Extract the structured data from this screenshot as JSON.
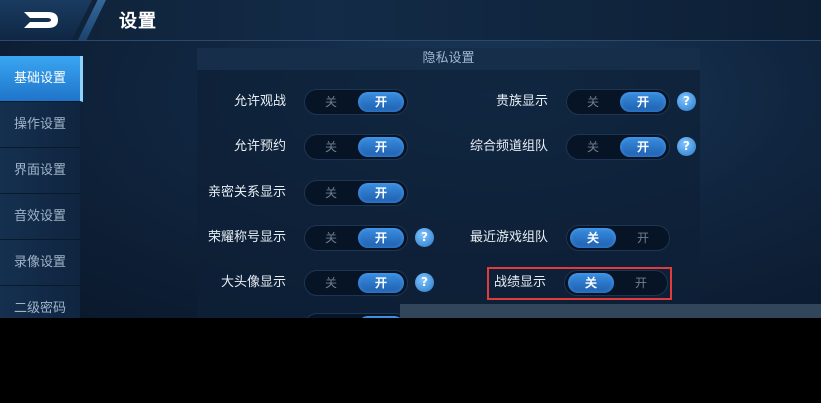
{
  "header": {
    "title": "设置"
  },
  "sidebar": {
    "items": [
      {
        "label": "基础设置",
        "active": true
      },
      {
        "label": "操作设置"
      },
      {
        "label": "界面设置"
      },
      {
        "label": "音效设置"
      },
      {
        "label": "录像设置"
      },
      {
        "label": "二级密码"
      }
    ]
  },
  "panel": {
    "title": "隐私设置"
  },
  "toggle_text": {
    "off": "关",
    "on": "开"
  },
  "help_glyph": "?",
  "left_settings": [
    {
      "label": "允许观战",
      "state": "开",
      "help": false
    },
    {
      "label": "允许预约",
      "state": "开",
      "help": false
    },
    {
      "label": "亲密关系显示",
      "state": "开",
      "help": false
    },
    {
      "label": "荣耀称号显示",
      "state": "开",
      "help": true
    },
    {
      "label": "大头像显示",
      "state": "开",
      "help": true
    }
  ],
  "right_settings": [
    {
      "label": "贵族显示",
      "state": "开",
      "help": true
    },
    {
      "label": "综合频道组队",
      "state": "开",
      "help": true
    },
    {
      "label": "最近游戏组队",
      "state": "关",
      "help": false
    },
    {
      "label": "战绩显示",
      "state": "关",
      "help": false,
      "highlighted": true
    }
  ],
  "colors": {
    "accent": "#2f7fd6",
    "highlight_border": "#e23b3b",
    "background": "#10253f"
  }
}
